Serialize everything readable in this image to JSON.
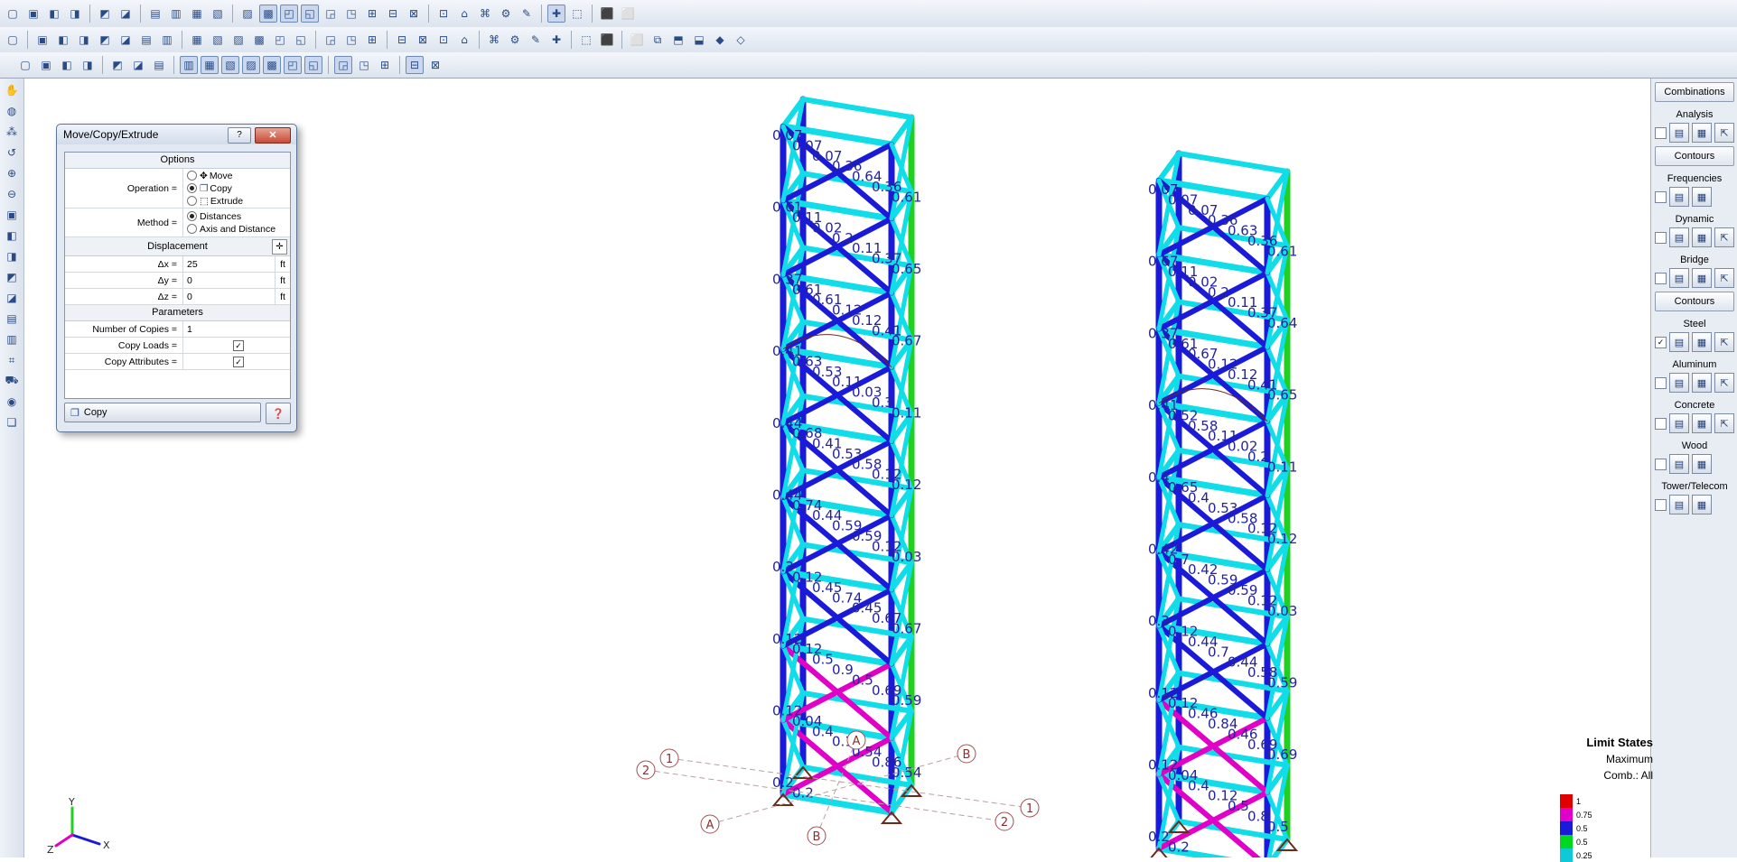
{
  "toolbars": {
    "row1": [
      "new-icon",
      "open-icon",
      "save-icon",
      "print-icon",
      "undo-icon",
      "redo-icon",
      "render-icon",
      "3d-icon",
      "2d-icon",
      "view-icon",
      "camera-icon",
      "select-icon",
      "member-icon",
      "node-icon",
      "table-icon",
      "beam-icon",
      "grid-icon",
      "brace-icon",
      "plate-icon",
      "solid-icon",
      "box-icon",
      "column-icon",
      "truss-icon",
      "section-icon",
      "load-icon",
      "result-icon",
      "query-icon",
      "help-icon"
    ],
    "row2": [
      "table-icon",
      "check-icon",
      "check2-icon",
      "check3-icon",
      "check4-icon",
      "check5-icon",
      "check6-icon",
      "check7-icon",
      "delete-icon",
      "delete2-icon",
      "delete3-icon",
      "delete4-icon",
      "delete5-icon",
      "delete6-icon",
      "grid-view-icon",
      "grid-view2-icon",
      "grid-view3-icon",
      "arrow-icon",
      "dim-icon",
      "dim2-icon",
      "dim3-icon",
      "dim4-icon",
      "tool-icon",
      "tool2-icon",
      "tool3-icon",
      "color-wheel-icon",
      "pencil-icon",
      "copy-icon",
      "copy2-icon",
      "copy3-icon",
      "copy4-icon",
      "copy5-icon",
      "unit-icon"
    ],
    "row3": [
      "select-box-icon",
      "select-box2-icon",
      "select-box3-icon",
      "select-box4-icon",
      "window-icon",
      "window2-icon",
      "window3-icon",
      "pointer-icon",
      "pointer2-icon",
      "pointer3-icon",
      "pointer4-icon",
      "pointer5-icon",
      "pointer6-icon",
      "pointer7-icon",
      "pointer8-icon",
      "pointer9-icon",
      "pointer10-icon",
      "pointer11-icon",
      "checkbox-icon"
    ]
  },
  "dialog": {
    "title": "Move/Copy/Extrude",
    "help_btn": "?",
    "close_btn": "✕",
    "options_header": "Options",
    "operation_label": "Operation =",
    "operations": [
      "Move",
      "Copy",
      "Extrude"
    ],
    "operation_selected": "Copy",
    "method_label": "Method =",
    "methods": [
      "Distances",
      "Axis and Distance"
    ],
    "method_selected": "Distances",
    "displacement_header": "Displacement",
    "dx_label": "Δx =",
    "dx_value": "25",
    "dy_label": "Δy =",
    "dy_value": "0",
    "dz_label": "Δz =",
    "dz_value": "0",
    "unit": "ft",
    "parameters_header": "Parameters",
    "copies_label": "Number of Copies =",
    "copies_value": "1",
    "copy_loads_label": "Copy Loads =",
    "copy_loads": true,
    "copy_attributes_label": "Copy Attributes =",
    "copy_attributes": true,
    "copy_button": "Copy"
  },
  "right_panel": {
    "combinations_btn": "Combinations",
    "analysis_label": "Analysis",
    "contours_btn": "Contours",
    "frequencies_label": "Frequencies",
    "dynamic_label": "Dynamic",
    "bridge_label": "Bridge",
    "contours_btn2": "Contours",
    "steel_label": "Steel",
    "aluminum_label": "Aluminum",
    "concrete_label": "Concrete",
    "wood_label": "Wood",
    "tower_label": "Tower/Telecom"
  },
  "legend": {
    "title": "Limit States",
    "line1": "Maximum",
    "line2": "Comb.: All",
    "items": [
      {
        "value": "1",
        "color": "#e00000"
      },
      {
        "value": "0.75",
        "color": "#e000c8"
      },
      {
        "value": "0.5",
        "color": "#1a1ad8"
      },
      {
        "value": "0.5",
        "color": "#00d820"
      },
      {
        "value": "0.25",
        "color": "#10c8d8"
      }
    ]
  },
  "grid_labels": {
    "tower1": [
      "1",
      "2",
      "A",
      "B",
      "1",
      "2",
      "A",
      "B"
    ],
    "tower1_keys": [
      "g1a",
      "g2a",
      "gAa",
      "gBa",
      "g1b",
      "g2b",
      "gAb",
      "gBb"
    ]
  },
  "tower1_labels": [
    "0.07",
    "0.07",
    "0.07",
    "0.36",
    "0.64",
    "0.36",
    "0.61",
    "0.61",
    "0.11",
    "0.02",
    "0.2",
    "0.11",
    "0.37",
    "0.65",
    "0.37",
    "0.61",
    "0.61",
    "0.12",
    "0.12",
    "0.41",
    "0.67",
    "0.41",
    "0.63",
    "0.53",
    "0.11",
    "0.03",
    "0.3",
    "0.11",
    "0.44",
    "0.68",
    "0.41",
    "0.53",
    "0.58",
    "0.12",
    "0.12",
    "0.44",
    "0.74",
    "0.44",
    "0.59",
    "0.59",
    "0.12",
    "0.03",
    "0.3",
    "0.12",
    "0.45",
    "0.74",
    "0.45",
    "0.67",
    "0.67",
    "0.12",
    "0.12",
    "0.5",
    "0.9",
    "0.5",
    "0.69",
    "0.59",
    "0.12",
    "0.04",
    "0.4",
    "0.12",
    "0.54",
    "0.86",
    "0.54",
    "0.2",
    "0.2"
  ],
  "tower2_labels": [
    "0.07",
    "0.07",
    "0.07",
    "0.36",
    "0.63",
    "0.36",
    "0.61",
    "0.67",
    "0.11",
    "0.02",
    "0.2",
    "0.11",
    "0.37",
    "0.64",
    "0.37",
    "0.61",
    "0.67",
    "0.12",
    "0.12",
    "0.41",
    "0.65",
    "0.41",
    "0.52",
    "0.58",
    "0.11",
    "0.02",
    "0.2",
    "0.11",
    "0.4",
    "0.65",
    "0.4",
    "0.53",
    "0.58",
    "0.12",
    "0.12",
    "0.42",
    "0.7",
    "0.42",
    "0.59",
    "0.59",
    "0.12",
    "0.03",
    "0.3",
    "0.12",
    "0.44",
    "0.7",
    "0.44",
    "0.58",
    "0.59",
    "0.12",
    "0.12",
    "0.46",
    "0.84",
    "0.46",
    "0.69",
    "0.69",
    "0.12",
    "0.04",
    "0.4",
    "0.12",
    "0.5",
    "0.8",
    "0.5",
    "0.2",
    "0.2"
  ],
  "axes": {
    "y": "Y",
    "x": "X",
    "z": "Z"
  }
}
